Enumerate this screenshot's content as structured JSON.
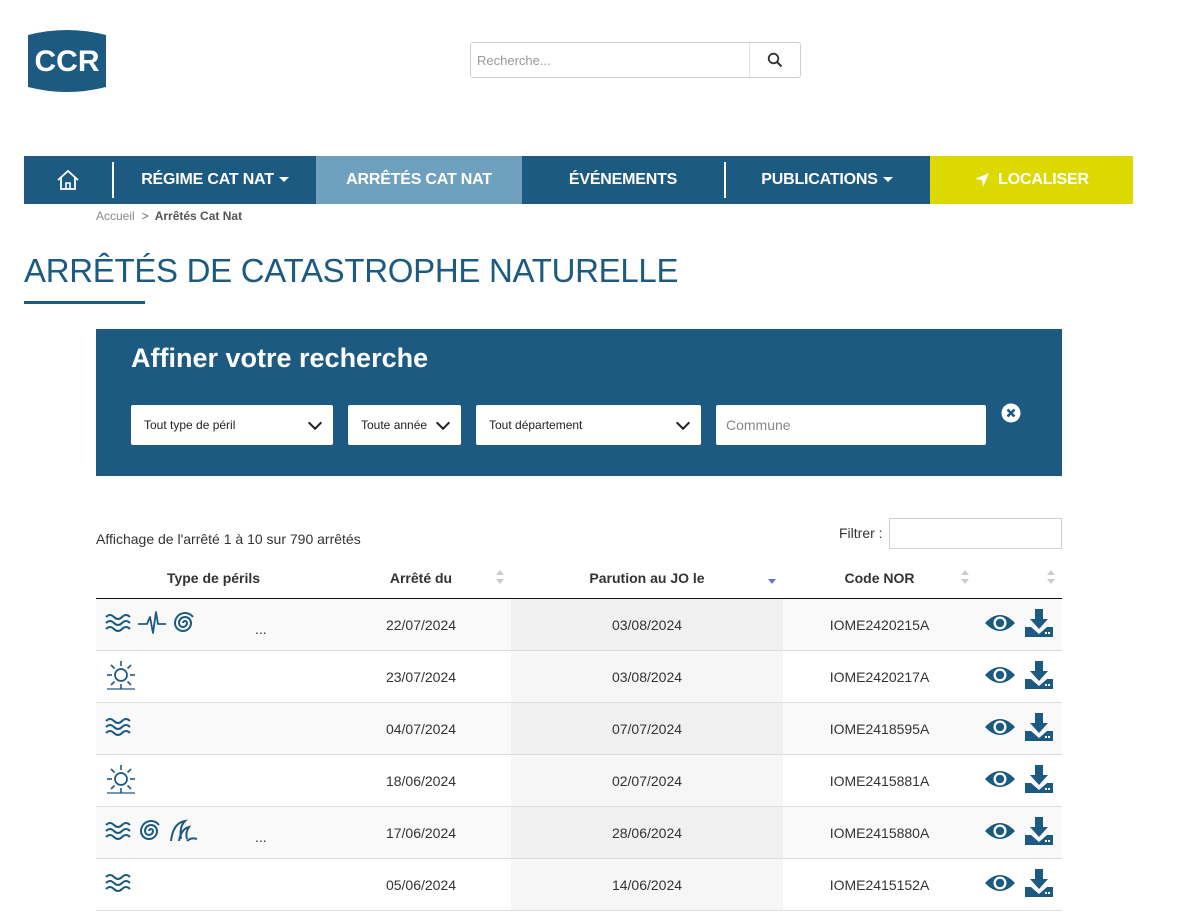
{
  "logo": {
    "text": "CCR"
  },
  "search": {
    "placeholder": "Recherche..."
  },
  "nav": {
    "items": [
      {
        "label": "RÉGIME CAT NAT",
        "dropdown": true
      },
      {
        "label": "ARRÊTÉS CAT NAT",
        "active": true
      },
      {
        "label": "ÉVÉNEMENTS"
      },
      {
        "label": "PUBLICATIONS",
        "dropdown": true
      },
      {
        "label": "LOCALISER"
      }
    ]
  },
  "breadcrumb": {
    "home": "Accueil",
    "current": "Arrêtés Cat Nat"
  },
  "page": {
    "title": "ARRÊTÉS DE CATASTROPHE NATURELLE"
  },
  "filters": {
    "title": "Affiner votre recherche",
    "peril": "Tout type de péril",
    "annee": "Toute année",
    "departement": "Tout département",
    "commune_placeholder": "Commune"
  },
  "table": {
    "info": "Affichage de l'arrêté 1 à 10 sur 790 arrêtés",
    "filter_label": "Filtrer :",
    "headers": [
      "Type de périls",
      "Arrêté du",
      "Parution au JO le",
      "Code NOR"
    ],
    "more_label": "...",
    "rows": [
      {
        "icons": [
          "flood-icon",
          "earthquake-icon",
          "cyclone-icon"
        ],
        "more": true,
        "arrete": "22/07/2024",
        "parution": "03/08/2024",
        "nor": "IOME2420215A"
      },
      {
        "icons": [
          "drought-icon"
        ],
        "more": false,
        "arrete": "23/07/2024",
        "parution": "03/08/2024",
        "nor": "IOME2420217A"
      },
      {
        "icons": [
          "flood-icon"
        ],
        "more": false,
        "arrete": "04/07/2024",
        "parution": "07/07/2024",
        "nor": "IOME2418595A"
      },
      {
        "icons": [
          "drought-icon"
        ],
        "more": false,
        "arrete": "18/06/2024",
        "parution": "02/07/2024",
        "nor": "IOME2415881A"
      },
      {
        "icons": [
          "flood-icon",
          "cyclone-icon",
          "wave-icon"
        ],
        "more": true,
        "arrete": "17/06/2024",
        "parution": "28/06/2024",
        "nor": "IOME2415880A"
      },
      {
        "icons": [
          "flood-icon"
        ],
        "more": false,
        "arrete": "05/06/2024",
        "parution": "14/06/2024",
        "nor": "IOME2415152A"
      }
    ]
  },
  "colors": {
    "primary": "#1c5a81",
    "nav_active": "#6fa1bf",
    "localiser": "#dcd900"
  }
}
